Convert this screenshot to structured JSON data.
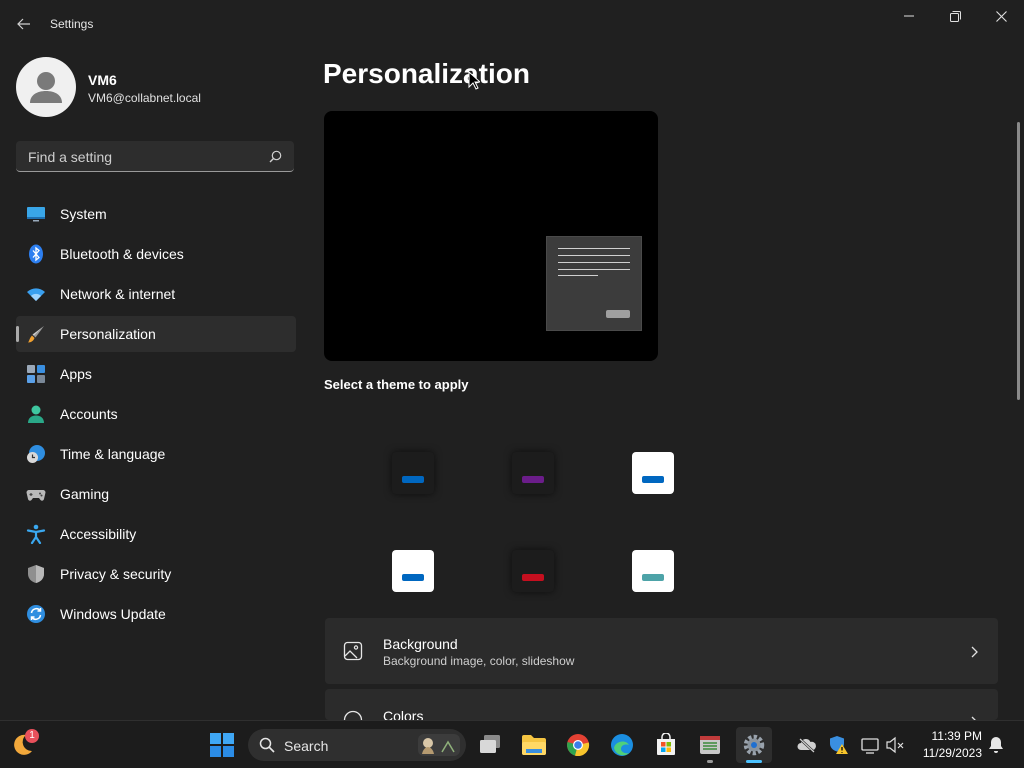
{
  "app": {
    "title": "Settings"
  },
  "user": {
    "name": "VM6",
    "email": "VM6@collabnet.local"
  },
  "search": {
    "placeholder": "Find a setting"
  },
  "nav": {
    "items": [
      {
        "label": "System",
        "icon": "monitor-icon"
      },
      {
        "label": "Bluetooth & devices",
        "icon": "bluetooth-icon"
      },
      {
        "label": "Network & internet",
        "icon": "wifi-icon"
      },
      {
        "label": "Personalization",
        "icon": "brush-icon",
        "selected": true
      },
      {
        "label": "Apps",
        "icon": "apps-icon"
      },
      {
        "label": "Accounts",
        "icon": "person-icon"
      },
      {
        "label": "Time & language",
        "icon": "globe-clock-icon"
      },
      {
        "label": "Gaming",
        "icon": "gamepad-icon"
      },
      {
        "label": "Accessibility",
        "icon": "accessibility-icon"
      },
      {
        "label": "Privacy & security",
        "icon": "shield-icon"
      },
      {
        "label": "Windows Update",
        "icon": "update-icon"
      }
    ]
  },
  "main": {
    "title": "Personalization",
    "theme_heading": "Select a theme to apply",
    "themes": [
      {
        "bg": "#1c1c1c",
        "accent": "#0067c0"
      },
      {
        "bg": "#1c1c1c",
        "accent": "#6b1d8a"
      },
      {
        "bg": "#ffffff",
        "accent": "#0067c0"
      },
      {
        "bg": "#ffffff",
        "accent": "#0067c0"
      },
      {
        "bg": "#1c1c1c",
        "accent": "#c50f1f"
      },
      {
        "bg": "#ffffff",
        "accent": "#4da3a8"
      }
    ],
    "cards": [
      {
        "title": "Background",
        "subtitle": "Background image, color, slideshow",
        "icon": "image-icon"
      },
      {
        "title": "Colors",
        "subtitle": "",
        "icon": "palette-icon"
      }
    ]
  },
  "taskbar": {
    "search_label": "Search",
    "time": "11:39 PM",
    "date": "11/29/2023",
    "widget_badge": "1"
  },
  "colors": {
    "accent": "#4cc2ff",
    "background": "#202020",
    "card": "#2b2b2b"
  }
}
